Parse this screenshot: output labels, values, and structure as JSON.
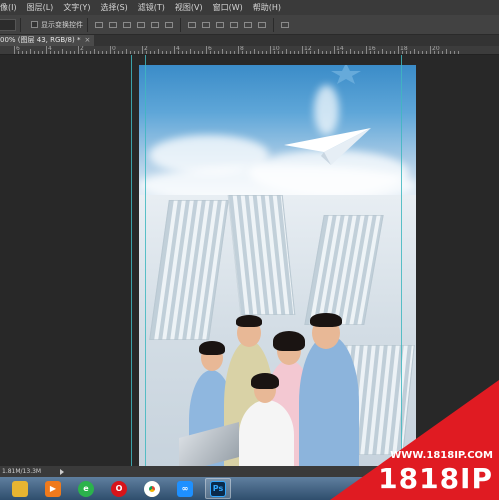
{
  "menu": [
    "像(I)",
    "图层(L)",
    "文字(Y)",
    "选择(S)",
    "滤镜(T)",
    "视图(V)",
    "窗口(W)",
    "帮助(H)"
  ],
  "options": {
    "show_transform_label": "显示变换控件"
  },
  "document_tab": {
    "title": "00% (图层 43, RGB/8) *",
    "close": "×"
  },
  "ruler": {
    "labels": [
      "6",
      "4",
      "2",
      "0",
      "2",
      "4",
      "6",
      "8",
      "10",
      "12",
      "14",
      "16",
      "18",
      "20"
    ]
  },
  "status": {
    "doc_size": "1.81M/13.3M"
  },
  "taskbar": {
    "apps": [
      {
        "name": "file-explorer",
        "glyph": "",
        "color": "#e8b531"
      },
      {
        "name": "media-player",
        "glyph": "▶",
        "color": "#f07a1c"
      },
      {
        "name": "360-browser",
        "glyph": "e",
        "color": "#2bb24c"
      },
      {
        "name": "opera",
        "glyph": "O",
        "color": "#d7141a"
      },
      {
        "name": "chrome",
        "glyph": "",
        "color": "#4285f4"
      },
      {
        "name": "baidu-netdisk",
        "glyph": "∞",
        "color": "#1e90ff"
      },
      {
        "name": "photoshop",
        "glyph": "Ps",
        "color": "#0a2a4a"
      }
    ]
  },
  "watermark": {
    "url": "WWW.1818IP.COM",
    "brand": "1818IP"
  },
  "colors": {
    "guide": "#3fb7c0",
    "watermark_red": "#e01b22",
    "taskbar_top": "#5f7f9f"
  }
}
